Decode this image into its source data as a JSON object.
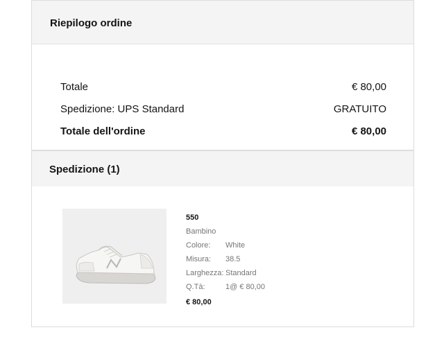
{
  "summary": {
    "title": "Riepilogo ordine",
    "rows": [
      {
        "label": "Totale",
        "value": "€ 80,00"
      },
      {
        "label": "Spedizione: UPS Standard",
        "value": "GRATUITO"
      },
      {
        "label": "Totale dell'ordine",
        "value": "€ 80,00"
      }
    ]
  },
  "shipment": {
    "title": "Spedizione (1)",
    "product": {
      "image_icon": "sneaker-image",
      "name": "550",
      "category": "Bambino",
      "color_label": "Colore:",
      "color_value": "White",
      "size_label": "Misura:",
      "size_value": "38.5",
      "width_label": "Larghezza:",
      "width_value": "Standard",
      "qty_label": "Q.Tà:",
      "qty_value": "1@ € 80,00",
      "price": "€ 80,00"
    }
  }
}
